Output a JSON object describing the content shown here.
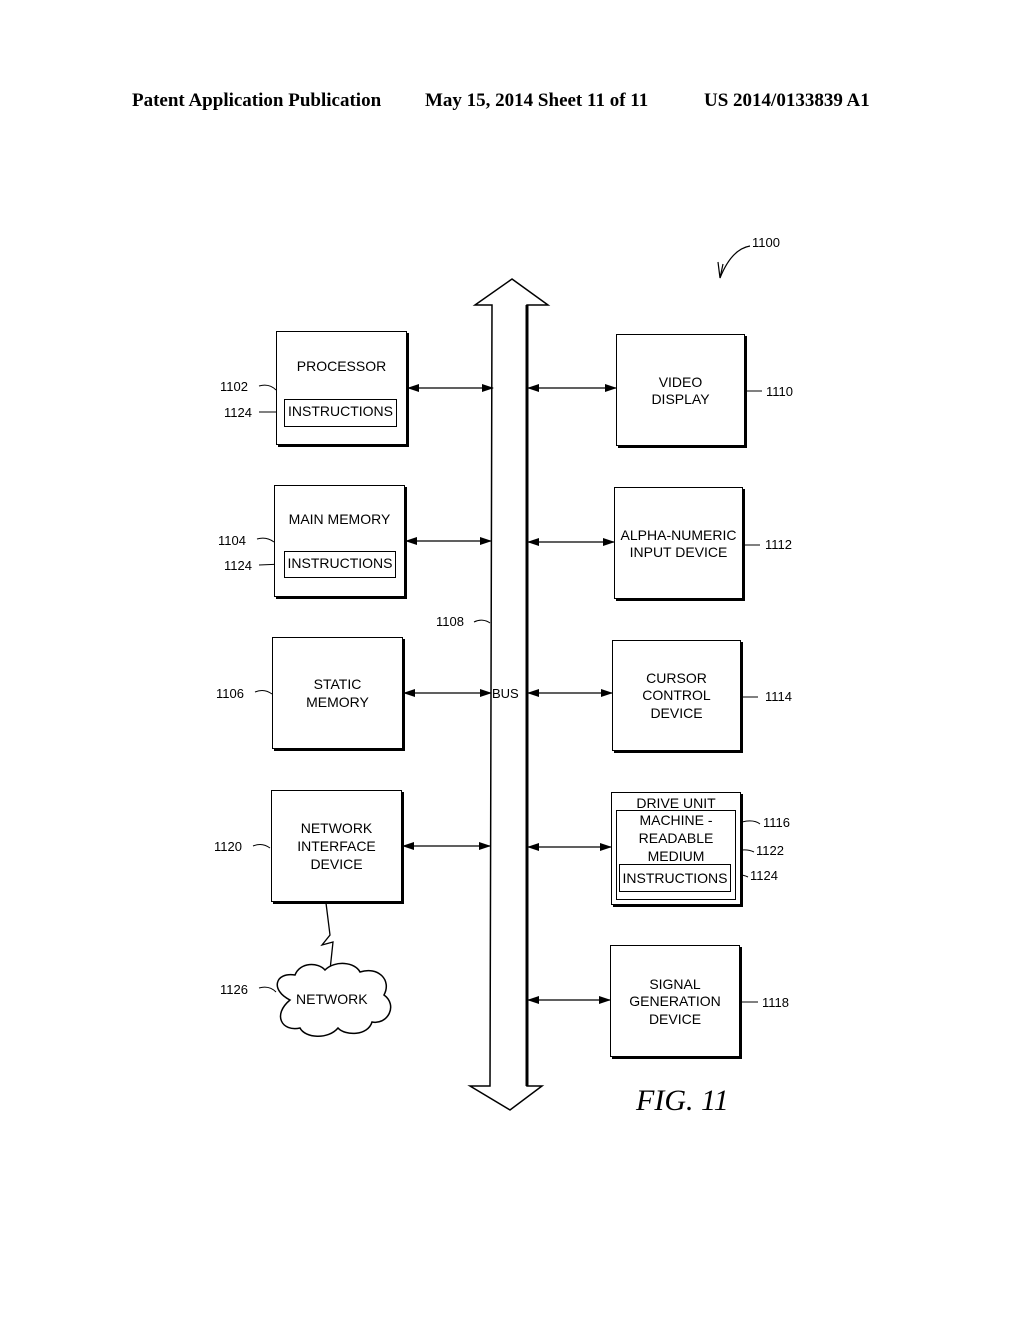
{
  "header": {
    "publication": "Patent Application Publication",
    "date_sheet": "May 15, 2014  Sheet 11 of 11",
    "number": "US 2014/0133839 A1"
  },
  "figure": {
    "ref": "1100",
    "caption": "FIG. 11",
    "bus": {
      "label": "BUS",
      "ref": "1108"
    },
    "left": {
      "processor": {
        "label": "PROCESSOR",
        "ref": "1102",
        "inner": "INSTRUCTIONS",
        "inner_ref": "1124"
      },
      "main_memory": {
        "label": "MAIN MEMORY",
        "ref": "1104",
        "inner": "INSTRUCTIONS",
        "inner_ref": "1124"
      },
      "static_memory": {
        "line1": "STATIC",
        "line2": "MEMORY",
        "ref": "1106"
      },
      "network_interface": {
        "line1": "NETWORK",
        "line2": "INTERFACE",
        "line3": "DEVICE",
        "ref": "1120"
      },
      "network": {
        "label": "NETWORK",
        "ref": "1126"
      }
    },
    "right": {
      "video_display": {
        "line1": "VIDEO",
        "line2": "DISPLAY",
        "ref": "1110"
      },
      "alpha_numeric": {
        "line1": "ALPHA-NUMERIC",
        "line2": "INPUT DEVICE",
        "ref": "1112"
      },
      "cursor_control": {
        "line1": "CURSOR",
        "line2": "CONTROL",
        "line3": "DEVICE",
        "ref": "1114"
      },
      "drive_unit": {
        "label": "DRIVE UNIT",
        "ref": "1116",
        "medium_line1": "MACHINE -",
        "medium_line2": "READABLE",
        "medium_line3": "MEDIUM",
        "medium_ref": "1122",
        "inner": "INSTRUCTIONS",
        "inner_ref": "1124"
      },
      "signal_generation": {
        "line1": "SIGNAL",
        "line2": "GENERATION",
        "line3": "DEVICE",
        "ref": "1118"
      }
    }
  }
}
